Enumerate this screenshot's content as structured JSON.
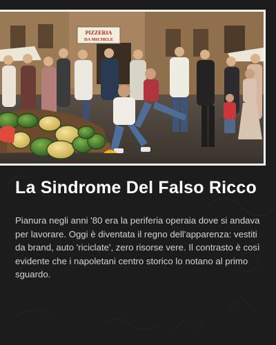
{
  "colors": {
    "background": "#1c1c1c",
    "title_text": "#ffffff",
    "body_text": "#d4d4d4",
    "sign_text": "#b3231d"
  },
  "article": {
    "image_alt": "Folla in una piazza di Napoli che ride davanti a una pizzeria, con un banco di angurie in primo piano",
    "image_sign": {
      "line1": "PIZZERIA",
      "line2": "DA MICHELE"
    },
    "title": "La Sindrome Del Falso Ricco",
    "body": "Pianura negli anni '80 era la periferia operaia dove si andava per lavorare. Oggi è diventata il regno dell'apparenza: vestiti da brand, auto 'riciclate', zero risorse vere. Il contrasto è così evidente che i napoletani centro storico lo notano al primo sguardo."
  }
}
